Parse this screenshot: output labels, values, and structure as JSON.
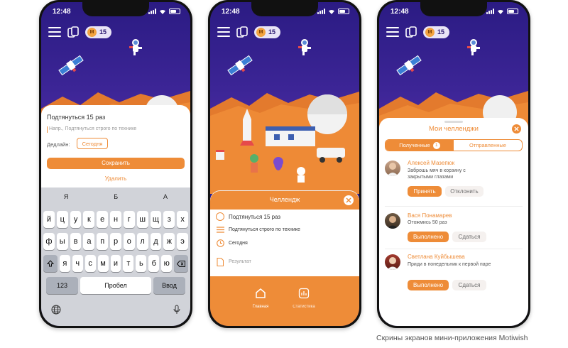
{
  "status": {
    "time": "12:48"
  },
  "header": {
    "coins": "15",
    "coin_letter": "M"
  },
  "phone1": {
    "title": "Подтянуться 15 раз",
    "note_placeholder": "Напр., Подтянуться строго по технике",
    "deadline_label": "Дедлайн:",
    "deadline_value": "Сегодня",
    "save_label": "Сохранить",
    "delete_label": "Удалить",
    "keyboard": {
      "suggestions": [
        "Я",
        "Б",
        "А"
      ],
      "row1": [
        "й",
        "ц",
        "у",
        "к",
        "е",
        "н",
        "г",
        "ш",
        "щ",
        "з",
        "х"
      ],
      "row2": [
        "ф",
        "ы",
        "в",
        "а",
        "п",
        "р",
        "о",
        "л",
        "д",
        "ж",
        "э"
      ],
      "row3": [
        "я",
        "ч",
        "с",
        "м",
        "и",
        "т",
        "ь",
        "б",
        "ю"
      ],
      "num_key": "123",
      "space_key": "Пробел",
      "return_key": "Ввод"
    }
  },
  "phone2": {
    "sheet_title": "Челлендж",
    "items": [
      "Подтянуться 15 раз",
      "Подтянуться строго по технике",
      "Сегодня",
      "Результат"
    ],
    "tabs": [
      {
        "label": "Главная"
      },
      {
        "label": "Статистика"
      }
    ]
  },
  "phone3": {
    "sheet_title": "Мои челленджи",
    "segment": {
      "received": "Полученные",
      "received_count": "1",
      "sent": "Отправленные"
    },
    "entries": [
      {
        "name": "Алексей Мазепюк",
        "text": "Заброшь мяч в корзину с закрытыми глазами",
        "primary": "Принять",
        "secondary": "Отклонить"
      },
      {
        "name": "Вася Понамарев",
        "text": "Отожмись 50 раз",
        "primary": "Выполнено",
        "secondary": "Сдаться"
      },
      {
        "name": "Светлана Куйбышева",
        "text": "Приди в понедельник к первой паре",
        "primary": "Выполнено",
        "secondary": "Сдаться"
      }
    ]
  },
  "caption": "Скрины экранов мини-приложения Motiwish",
  "colors": {
    "accent": "#ee8c38",
    "sky": "#2e1a86",
    "mars": "#ee8a36"
  }
}
